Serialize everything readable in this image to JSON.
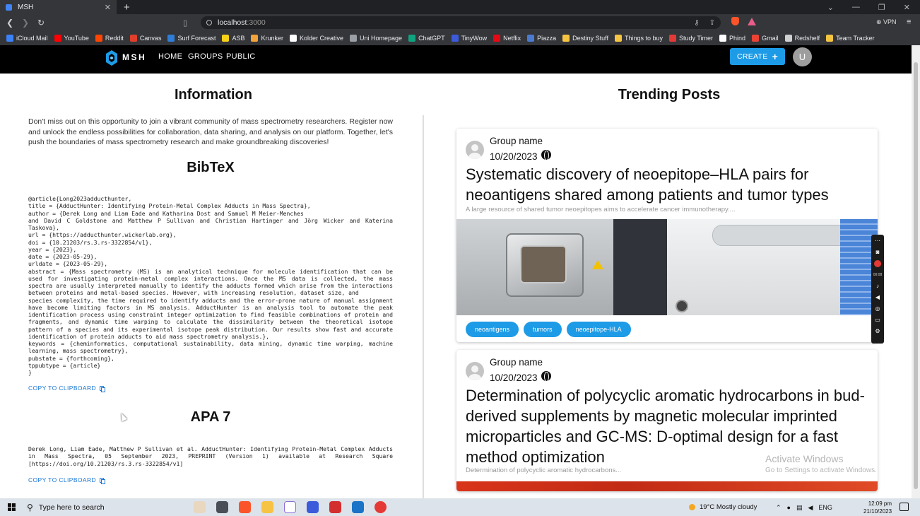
{
  "browser": {
    "tab_title": "MSH",
    "new_tab": "+",
    "url_host": "localhost",
    "url_port": ":3000",
    "vpn": "⊕ VPN",
    "bookmarks": [
      {
        "label": "iCloud Mail",
        "color": "#3b82f6"
      },
      {
        "label": "YouTube",
        "color": "#ff0000"
      },
      {
        "label": "Reddit",
        "color": "#ff4500"
      },
      {
        "label": "Canvas",
        "color": "#e13f2b"
      },
      {
        "label": "Surf Forecast",
        "color": "#2e7dd7"
      },
      {
        "label": "ASB",
        "color": "#f7d117"
      },
      {
        "label": "Krunker",
        "color": "#f2a33a"
      },
      {
        "label": "Kolder Creative",
        "color": "#ffffff"
      },
      {
        "label": "Uni Homepage",
        "color": "#9aa0a6"
      },
      {
        "label": "ChatGPT",
        "color": "#10a37f"
      },
      {
        "label": "TinyWow",
        "color": "#3b5bdb"
      },
      {
        "label": "Netflix",
        "color": "#e50914"
      },
      {
        "label": "Piazza",
        "color": "#4a7bd0"
      },
      {
        "label": "Destiny Stuff",
        "color": "#f5c542"
      },
      {
        "label": "Things to buy",
        "color": "#f5c542"
      },
      {
        "label": "Study Timer",
        "color": "#e53935"
      },
      {
        "label": "Phind",
        "color": "#ffffff"
      },
      {
        "label": "Gmail",
        "color": "#ea4335"
      },
      {
        "label": "Redshelf",
        "color": "#d0d0d0"
      },
      {
        "label": "Team Tracker",
        "color": "#f5c542"
      }
    ]
  },
  "header": {
    "brand": "MSH",
    "nav": [
      "HOME",
      "GROUPS",
      "PUBLIC"
    ],
    "create_label": "CREATE",
    "create_icon": "+",
    "user_initial": "U"
  },
  "info": {
    "title": "Information",
    "text": "Don't miss out on this opportunity to join a vibrant community of mass spectrometry researchers. Register now and unlock the endless possibilities for collaboration, data sharing, and analysis on our platform. Together, let's push the boundaries of mass spectrometry research and make groundbreaking discoveries!",
    "bibtex_title": "BibTeX",
    "bibtex": "@article{Long2023adducthunter,\ntitle = {AdductHunter: Identifying Protein-Metal Complex Adducts in Mass Spectra},\nauthor = {Derek Long and Liam Eade and Katharina Dost and Samuel M Meier-Menches\nand David C Goldstone and Matthew P Sullivan and Christian Hartinger and Jörg Wicker and Katerina Taskova},\nurl = {https://adducthunter.wickerlab.org},\ndoi = {10.21203/rs.3.rs-3322854/v1},\nyear = {2023},\ndate = {2023-05-29},\nurldate = {2023-05-29},\nabstract = {Mass spectrometry (MS) is an analytical technique for molecule identification that can be used for investigating protein-metal complex interactions. Once the MS data is collected, the mass spectra are usually interpreted manually to identify the adducts formed which arise from the interactions between proteins and metal-based species. However, with increasing resolution, dataset size, and\nspecies complexity, the time required to identify adducts and the error-prone nature of manual assignment have become limiting factors in MS analysis. AdductHunter is an analysis tool to automate the peak identification process using constraint integer optimization to find feasible combinations of protein and fragments, and dynamic time warping to calculate the dissimilarity between the theoretical isotope pattern of a species and its experimental isotope peak distribution. Our results show fast and accurate identification of protein adducts to aid mass spectrometry analysis.},\nkeywords = {cheminformatics, computational sustainability, data mining, dynamic time warping, machine learning, mass spectrometry},\npubstate = {forthcoming},\ntppubtype = {article}\n}",
    "copy_label": "COPY TO CLIPBOARD",
    "apa_title": "APA 7",
    "apa": "Derek Long, Liam Eade, Matthew P Sullivan et al. AdductHunter: Identifying Protein-Metal Complex Adducts in Mass Spectra, 05 September 2023, PREPRINT (Version 1) available at Research Square [https://doi.org/10.21203/rs.3.rs-3322854/v1]"
  },
  "trending": {
    "title": "Trending Posts",
    "posts": [
      {
        "group": "Group name",
        "date": "10/20/2023",
        "title": "Systematic discovery of neoepitope–HLA pairs for neoantigens shared among patients and tumor types",
        "excerpt": "A large resource of shared tumor neoepitopes aims to accelerate cancer immunotherapy....",
        "tags": [
          "neoantigens",
          "tumors",
          "neoepitope-HLA"
        ]
      },
      {
        "group": "Group name",
        "date": "10/20/2023",
        "title": "Determination of polycyclic aromatic hydrocarbons in bud-derived supplements by magnetic molecular imprinted microparticles and GC-MS: D-optimal design for a fast method optimization",
        "excerpt": "Determination of polycyclic aromatic hydrocarbons..."
      }
    ]
  },
  "overlay": {
    "activate_title": "Activate Windows",
    "activate_sub": "Go to Settings to activate Windows.",
    "rec_time": "00:08"
  },
  "taskbar": {
    "search_placeholder": "Type here to search",
    "weather": "19°C  Mostly cloudy",
    "lang": "ENG",
    "time": "12:09 pm",
    "date": "21/10/2023"
  },
  "colors": {
    "accent": "#1e9be6",
    "header_bg": "#000000"
  }
}
